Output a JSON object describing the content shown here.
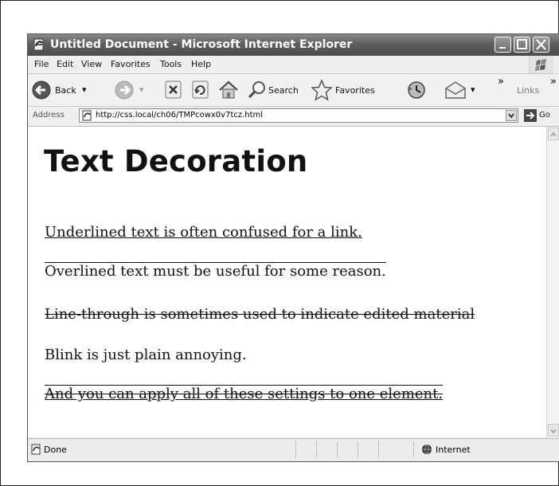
{
  "window": {
    "title": "Untitled Document - Microsoft Internet Explorer"
  },
  "menu": [
    "File",
    "Edit",
    "View",
    "Favorites",
    "Tools",
    "Help"
  ],
  "toolbar": {
    "back": "Back",
    "search": "Search",
    "favorites": "Favorites",
    "links": "Links",
    "chevron": "»"
  },
  "address": {
    "label": "Address",
    "url": "http://css.local/ch06/TMPcowx0v7tcz.html",
    "go": "Go"
  },
  "page": {
    "heading": "Text Decoration",
    "paragraphs": [
      "Underlined text is often confused for a link.",
      "Overlined text must be useful for some reason.",
      "Line-through is sometimes used to indicate edited material",
      "Blink is just plain annoying.",
      "And you can apply all of these settings to one element."
    ]
  },
  "status": {
    "text": "Done",
    "zone": "Internet"
  },
  "icons": {
    "app": "ie-page-icon",
    "back": "back-arrow-icon",
    "forward": "forward-arrow-icon",
    "stop": "stop-icon",
    "refresh": "refresh-icon",
    "home": "home-icon",
    "search": "search-magnifier-icon",
    "favorites": "favorites-star-icon",
    "history": "history-icon",
    "mail": "mail-icon",
    "go": "go-arrow-icon",
    "zone": "internet-globe-icon"
  }
}
